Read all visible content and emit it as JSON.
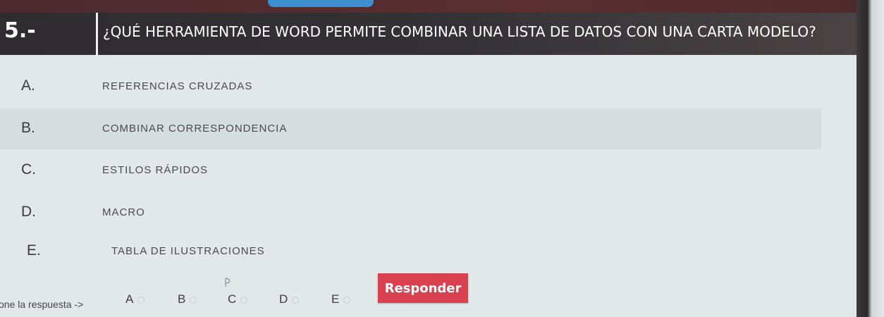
{
  "question": {
    "number": "5.-",
    "text": "¿QUÉ HERRAMIENTA DE WORD PERMITE COMBINAR UNA LISTA DE DATOS CON UNA CARTA MODELO?"
  },
  "options": [
    {
      "letter": "A.",
      "text": "REFERENCIAS CRUZADAS"
    },
    {
      "letter": "B.",
      "text": "COMBINAR CORRESPONDENCIA"
    },
    {
      "letter": "C.",
      "text": "ESTILOS RÁPIDOS"
    },
    {
      "letter": "D.",
      "text": "MACRO"
    },
    {
      "letter": "E.",
      "text": "TABLA DE ILUSTRACIONES"
    }
  ],
  "answer": {
    "label": "one la respuesta ->",
    "choices": [
      "A",
      "B",
      "C",
      "D",
      "E"
    ],
    "submit_label": "Responder"
  },
  "colors": {
    "header_bg": "#2e2c2f",
    "button_bg": "#d94050",
    "content_bg": "#e2e8e8"
  }
}
